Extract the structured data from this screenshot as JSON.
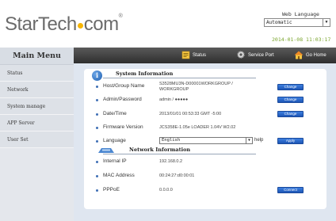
{
  "header": {
    "logo_text": "StarTech",
    "logo_suffix": "com",
    "web_language_label": "Web Language",
    "web_language_value": "Automatic",
    "datetime": "2014-01-08 11:03:17"
  },
  "sidebar": {
    "title": "Main Menu",
    "items": [
      {
        "label": "Status"
      },
      {
        "label": "Network"
      },
      {
        "label": "System manage"
      },
      {
        "label": "APP Server"
      },
      {
        "label": "User Set"
      }
    ]
  },
  "navbar": {
    "status_label": "Status",
    "service_port_label": "Service Port",
    "go_home_label": "Go Home"
  },
  "system_info": {
    "title": "System Information",
    "rows": {
      "host_group": {
        "label": "Host/Group Name",
        "value": "S3528MU3N-D00001WORKGROUP / WORKGROUP",
        "button": "Change"
      },
      "admin_password": {
        "label": "Admin/Password",
        "value": "admin / ●●●●●",
        "button": "Change"
      },
      "date_time": {
        "label": "Date/Time",
        "value": "2013/01/01 00:53:33 GMT -5:00",
        "button": "Change"
      },
      "firmware": {
        "label": "Firmware Version",
        "value": "JCS358E-1.05e LOADER 1.04V W2.02"
      },
      "language": {
        "label": "Language",
        "value": "English",
        "help": "help",
        "button": "Apply"
      }
    }
  },
  "network_info": {
    "title": "Network Information",
    "rows": {
      "internal_ip": {
        "label": "Internal IP",
        "value": "192.168.0.2"
      },
      "mac_address": {
        "label": "MAC Address",
        "value": "00:24:27:d0:00:01"
      },
      "pppoe": {
        "label": "PPPoE",
        "value": "0.0.0.0",
        "button": "Connect"
      }
    }
  }
}
